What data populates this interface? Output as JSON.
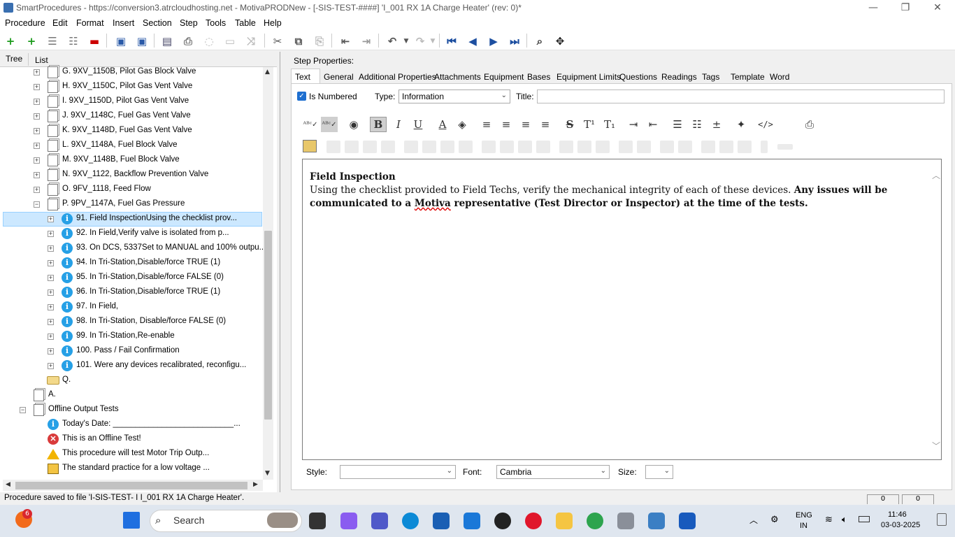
{
  "window": {
    "title": "SmartProcedures - https://conversion3.atrcloudhosting.net - MotivaPRODNew - [-SIS-TEST-####] 'I_001 RX 1A Charge Heater' (rev: 0)*",
    "minimize": "—",
    "maximize": "❐",
    "close": "✕"
  },
  "menu": [
    "Procedure",
    "Edit",
    "Format",
    "Insert",
    "Section",
    "Step",
    "Tools",
    "Table",
    "Help"
  ],
  "left_tabs": [
    "Tree",
    "List"
  ],
  "tree": [
    {
      "label": "G. 9XV_1150B, Pilot Gas Block Valve"
    },
    {
      "label": "H. 9XV_1150C, Pilot Gas Vent Valve"
    },
    {
      "label": "I. 9XV_1150D, Pilot Gas Vent Valve"
    },
    {
      "label": "J. 9XV_1148C, Fuel Gas Vent Valve"
    },
    {
      "label": "K. 9XV_1148D, Fuel Gas Vent Valve"
    },
    {
      "label": "L. 9XV_1148A, Fuel Block Valve"
    },
    {
      "label": "M. 9XV_1148B, Fuel Block Valve"
    },
    {
      "label": "N. 9XV_1122, Backflow Prevention Valve"
    },
    {
      "label": "O. 9FV_1118, Feed Flow"
    },
    {
      "label": "P. 9PV_1147A, Fuel Gas Pressure"
    },
    {
      "label": "91. Field InspectionUsing the checklist prov..."
    },
    {
      "label": "92. In Field,Verify valve is isolated from p..."
    },
    {
      "label": "93. On DCS,  5337Set to MANUAL and 100% outpu..."
    },
    {
      "label": "94. In Tri-Station,Disable/force TRUE (1)"
    },
    {
      "label": "95. In Tri-Station,Disable/force FALSE (0)"
    },
    {
      "label": "96. In Tri-Station,Disable/force TRUE (1)"
    },
    {
      "label": "97. In Field,"
    },
    {
      "label": "98. In Tri-Station, Disable/force FALSE (0)"
    },
    {
      "label": "99. In Tri-Station,Re-enable"
    },
    {
      "label": "100. Pass / Fail Confirmation"
    },
    {
      "label": "101. Were any devices recalibrated, reconfigu..."
    },
    {
      "label": "Q."
    },
    {
      "label": "A."
    },
    {
      "label": "Offline Output Tests"
    },
    {
      "label": "Today's Date: ___________________________..."
    },
    {
      "label": "This is an Offline Test!"
    },
    {
      "label": "This procedure will test Motor Trip Outp..."
    },
    {
      "label": "The standard practice for a low voltage ..."
    }
  ],
  "step_properties": {
    "label": "Step Properties:",
    "tabs": [
      "Text",
      "General",
      "Additional Properties",
      "Attachments",
      "Equipment",
      "Bases",
      "Equipment Limits",
      "Questions",
      "Readings",
      "Tags",
      "Template",
      "Word"
    ],
    "is_numbered_label": "Is Numbered",
    "is_numbered": true,
    "type_label": "Type:",
    "type_value": "Information",
    "title_label": "Title:",
    "title_value": ""
  },
  "editor": {
    "heading": "Field Inspection",
    "body_normal": "Using the checklist provided to Field Techs, verify the mechanical integrity of each of these devices. ",
    "body_bold_1": "Any issues will be communicated to a ",
    "body_bold_underline": "Motiva",
    "body_bold_2": " representative (Test Director or Inspector) at the time of the tests."
  },
  "bottom_fields": {
    "style_label": "Style:",
    "style_value": "",
    "font_label": "Font:",
    "font_value": "Cambria",
    "size_label": "Size:",
    "size_value": ""
  },
  "status": {
    "text": "Procedure saved to file 'I-SIS-TEST-      I I_001 RX 1A Charge Heater'.",
    "cells": [
      "0",
      "0"
    ]
  },
  "taskbar": {
    "search_placeholder": "Search",
    "notification_count": "6",
    "lang_1": "ENG",
    "lang_2": "IN",
    "time": "11:46",
    "date": "03-03-2025"
  }
}
